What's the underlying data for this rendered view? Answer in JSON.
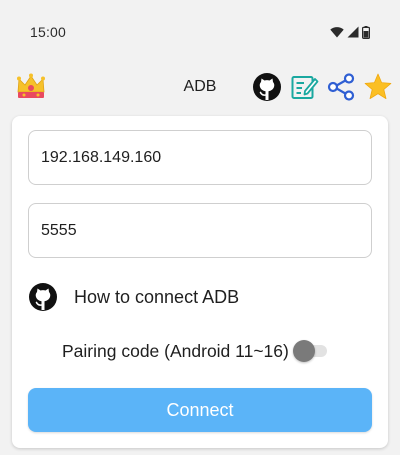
{
  "status_bar": {
    "time": "15:00",
    "icons": [
      "wifi-icon",
      "cell-signal-icon",
      "battery-icon"
    ]
  },
  "app_bar": {
    "title": "ADB",
    "left_icon": "crown-icon",
    "actions": [
      "github-icon",
      "edit-note-icon",
      "share-icon",
      "star-icon"
    ]
  },
  "form": {
    "ip_value": "192.168.149.160",
    "port_value": "5555",
    "howto_label": "How to connect ADB",
    "pairing_label": "Pairing code (Android 11~16)",
    "pairing_enabled": false,
    "connect_label": "Connect"
  },
  "colors": {
    "accent": "#5bb4f8",
    "share_icon": "#2f5fd3",
    "edit_icon": "#1aa8a0",
    "star_icon": "#fbbf24",
    "toggle_thumb_off": "#7a7a7a"
  }
}
